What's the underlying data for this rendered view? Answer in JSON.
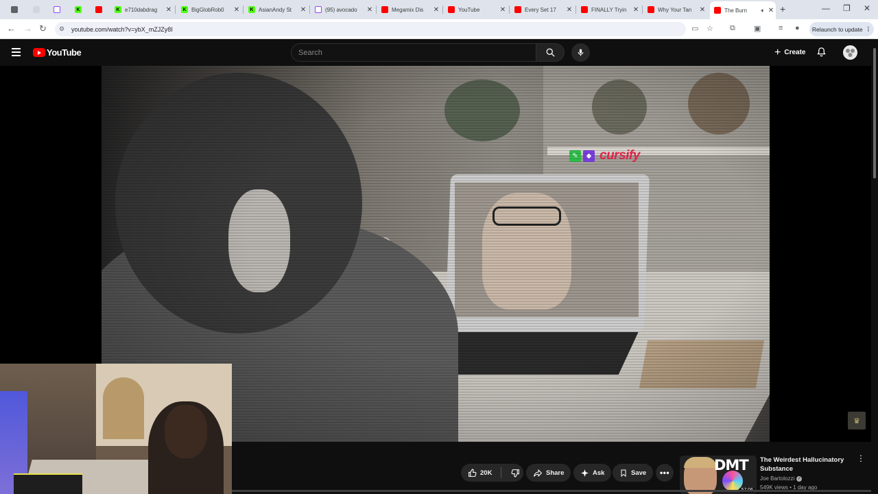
{
  "browser": {
    "tabs": [
      {
        "label": "",
        "favicon": "chrome-globe-icon"
      },
      {
        "label": "",
        "favicon": "blank-tab-icon"
      },
      {
        "label": "",
        "favicon": "twitch-icon"
      },
      {
        "label": "",
        "favicon": "kick-icon"
      },
      {
        "label": "",
        "favicon": "youtube-icon"
      },
      {
        "label": "e710dabdrag",
        "favicon": "kick-icon"
      },
      {
        "label": "BigGlobRob0",
        "favicon": "kick-icon"
      },
      {
        "label": "AsianAndy St",
        "favicon": "kick-icon"
      },
      {
        "label": "(95) avocado",
        "favicon": "twitch-icon"
      },
      {
        "label": "Megamix Dis",
        "favicon": "youtube-icon"
      },
      {
        "label": "YouTube",
        "favicon": "youtube-icon"
      },
      {
        "label": "Every Set 17",
        "favicon": "youtube-icon"
      },
      {
        "label": "FINALLY Tryin",
        "favicon": "youtube-icon"
      },
      {
        "label": "Why Your Tan",
        "favicon": "youtube-icon"
      },
      {
        "label": "The Burn",
        "favicon": "youtube-icon",
        "active": true
      }
    ],
    "url": "youtube.com/watch?v=ybX_mZJZy8I",
    "relaunch_label": "Relaunch to update"
  },
  "masthead": {
    "logo_text": "YouTube",
    "search_placeholder": "Search",
    "create_label": "Create"
  },
  "video": {
    "watermark_text": "cursify"
  },
  "actions": {
    "like_count": "20K",
    "share_label": "Share",
    "ask_label": "Ask",
    "save_label": "Save"
  },
  "recommendation": {
    "thumbnail_text": "DMT",
    "duration": "57:06",
    "title": "The Weirdest Hallucinatory Substance",
    "channel": "Joe Bartolozzi",
    "meta": "549K views • 1 day ago"
  },
  "colors": {
    "yt_red": "#ff0000",
    "kick_green": "#53fc18",
    "twitch_purple": "#9146ff",
    "background": "#0f0f0f",
    "pill": "#272727"
  }
}
